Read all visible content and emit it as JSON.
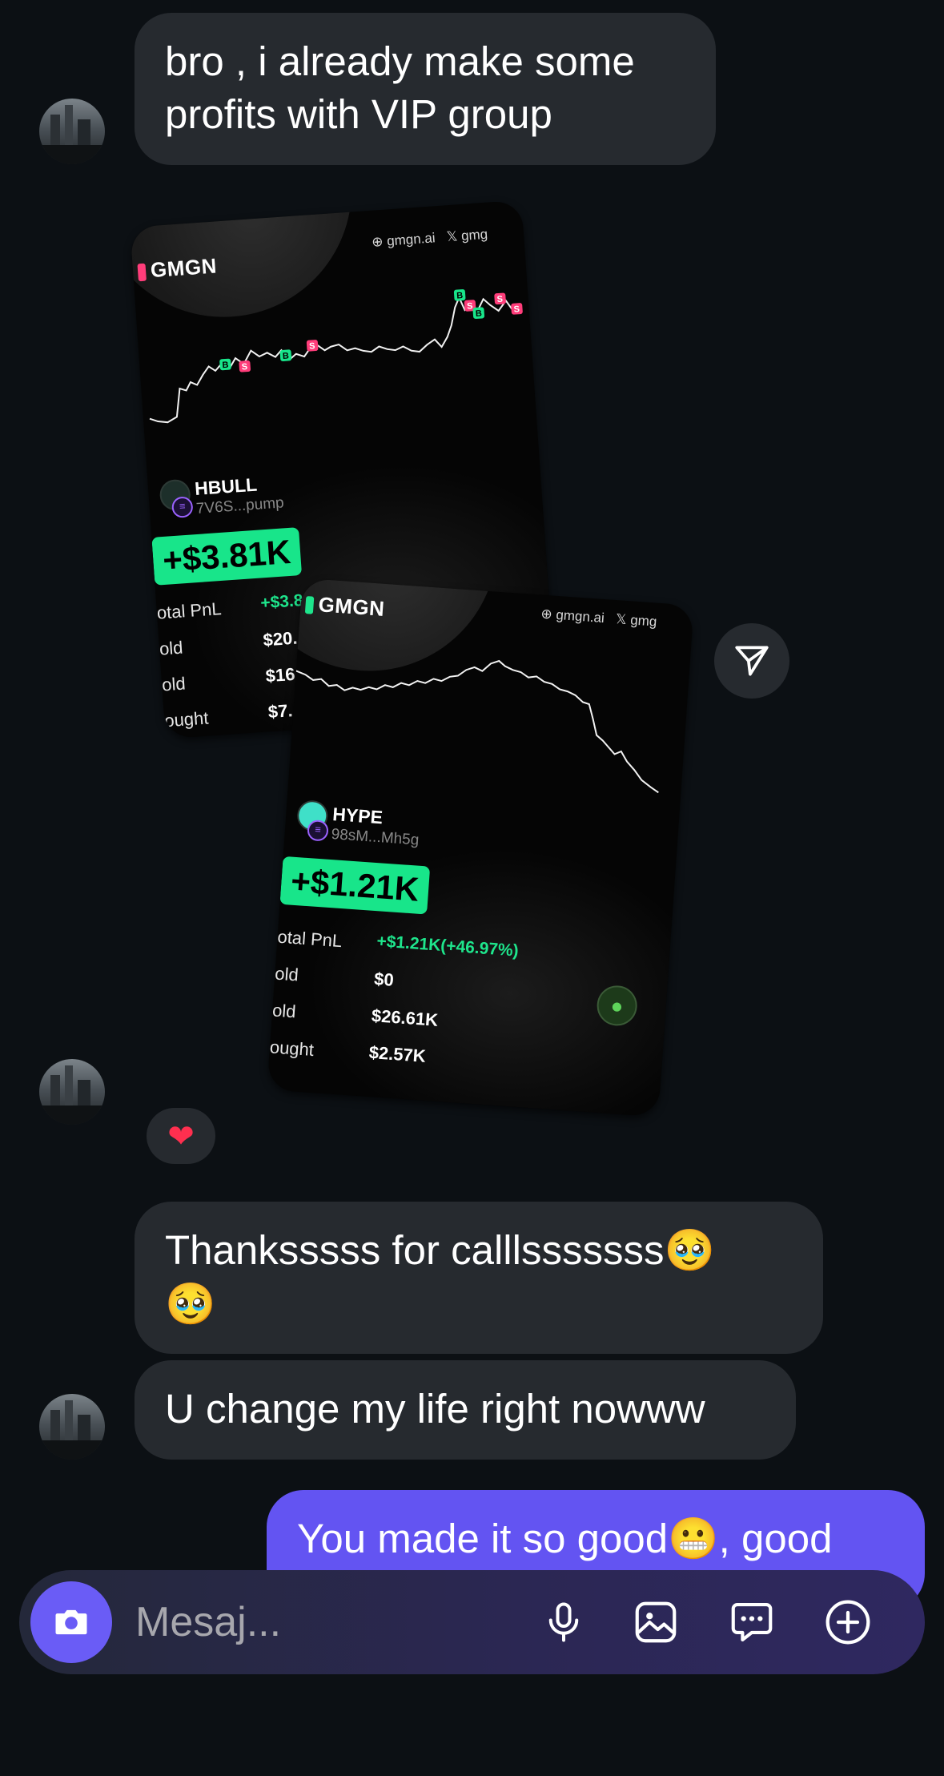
{
  "messages": {
    "m1": "bro , i already make some profits with VIP group",
    "m3_line1": "Thanksssss for calllsssssss",
    "m3_emoji": "🥹",
    "m3_emoji2": "🥹",
    "m4": "U change my life right nowww",
    "m5_text": "You made it so good",
    "m5_emoji": "😬",
    "m5_tail": ", good"
  },
  "reaction": "❤",
  "cards": [
    {
      "brand": "GMGN",
      "site": "gmgn.ai",
      "x_handle": "gmg",
      "token": "HBULL",
      "address": "7V6S...pump",
      "pnl_big": "+$3.81K",
      "labels": [
        "otal PnL",
        "old",
        "old",
        "ought"
      ],
      "values": [
        "+$3.81K(+43.63%)",
        "$20.",
        "$16.",
        "$7."
      ]
    },
    {
      "brand": "GMGN",
      "site": "gmgn.ai",
      "x_handle": "gmg",
      "token": "HYPE",
      "address": "98sM...Mh5g",
      "pnl_big": "+$1.21K",
      "labels": [
        "otal PnL",
        "old",
        "old",
        "ought"
      ],
      "values": [
        "+$1.21K(+46.97%)",
        "$0",
        "$26.61K",
        "$2.57K"
      ]
    }
  ],
  "composer": {
    "placeholder": "Mesaj...",
    "icons": [
      "camera-icon",
      "microphone-icon",
      "gallery-icon",
      "sticker-icon",
      "plus-icon"
    ]
  },
  "colors": {
    "background": "#0c1014",
    "incoming_bubble": "#262a2f",
    "outgoing_bubble": "#6354f2",
    "pnl_green": "#18e58a"
  }
}
